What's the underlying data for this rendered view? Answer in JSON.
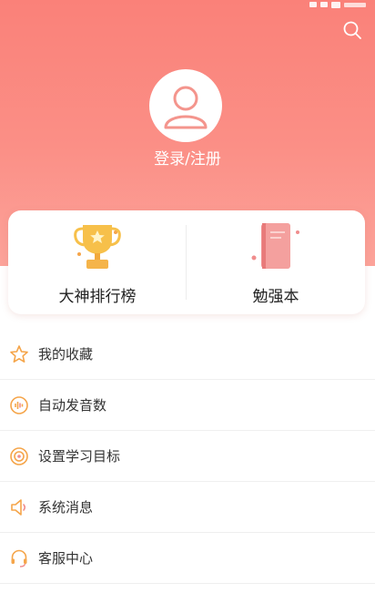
{
  "colors": {
    "header_gradient_top": "#fa8179",
    "header_gradient_bottom": "#fca39a",
    "icon_orange": "#f5a54a",
    "trophy_gold": "#f7c04a",
    "book_pink": "#f08d8d"
  },
  "header": {
    "login_label": "登录/注册",
    "search_icon": "search-icon",
    "avatar_icon": "user-avatar-icon"
  },
  "quick_links": [
    {
      "label": "大神排行榜",
      "icon": "trophy-icon"
    },
    {
      "label": "勉强本",
      "icon": "notebook-icon"
    }
  ],
  "menu": {
    "items": [
      {
        "label": "我的收藏",
        "icon": "star-icon"
      },
      {
        "label": "自动发音数",
        "icon": "sound-wave-icon"
      },
      {
        "label": "设置学习目标",
        "icon": "target-icon"
      },
      {
        "label": "系统消息",
        "icon": "speaker-icon"
      },
      {
        "label": "客服中心",
        "icon": "headset-icon"
      }
    ]
  }
}
